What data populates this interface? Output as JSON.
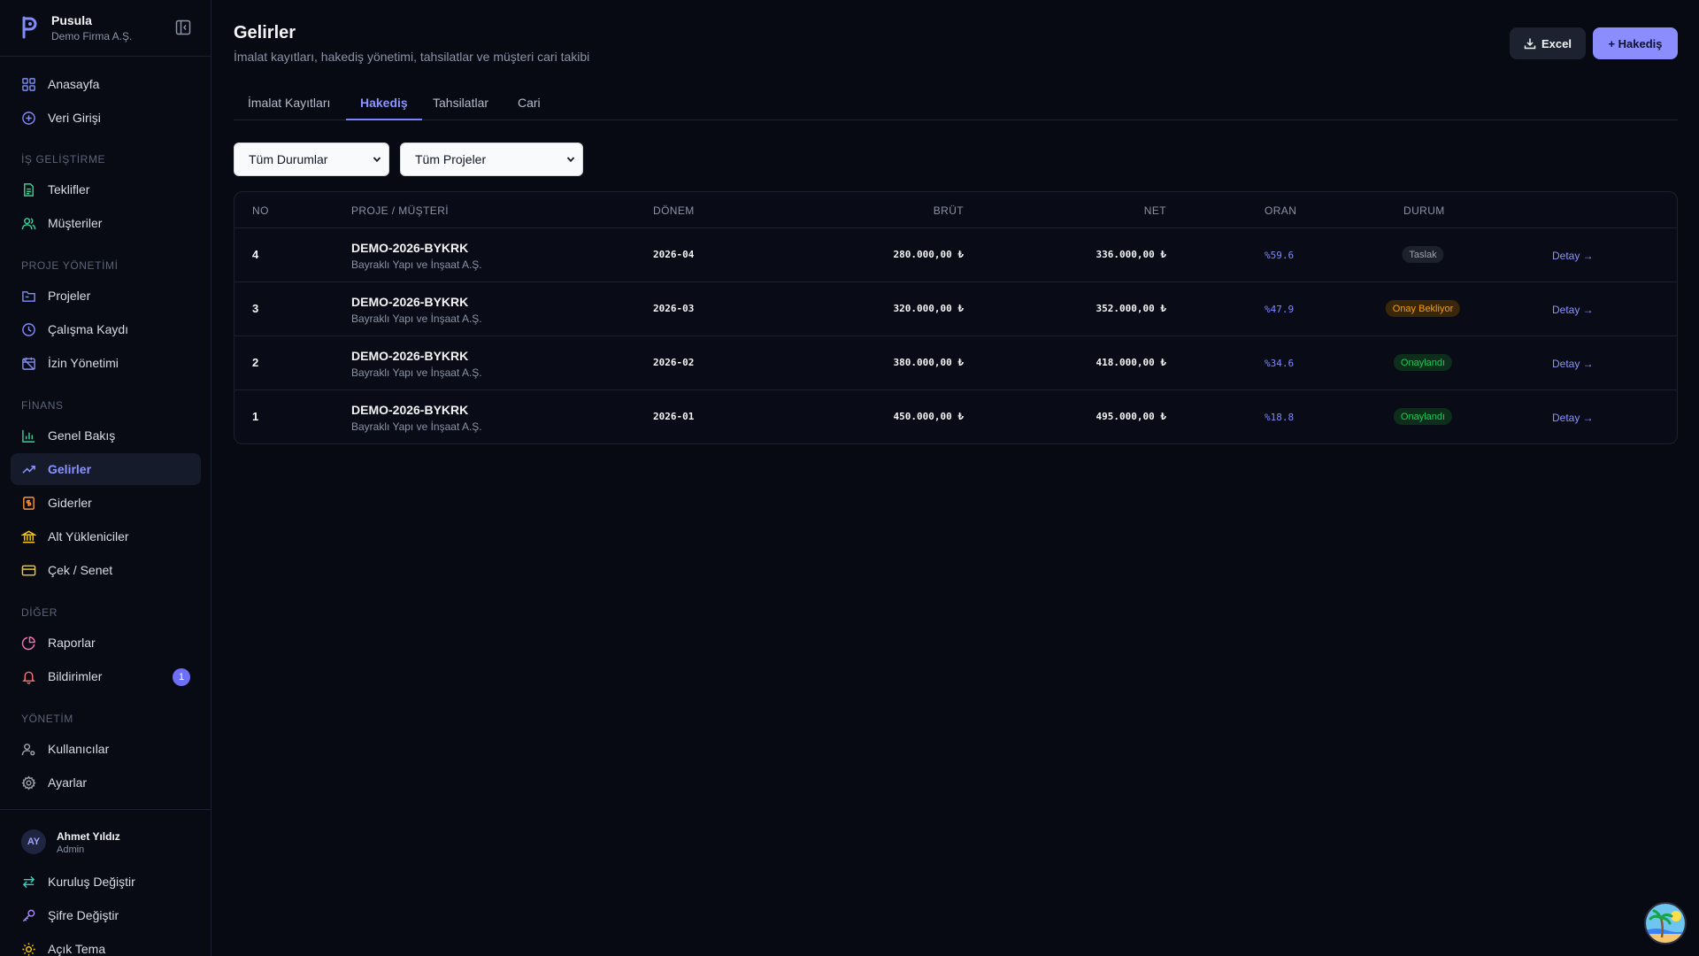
{
  "brand": {
    "name": "Pusula",
    "company": "Demo Firma A.Ş."
  },
  "sidebar": {
    "top_items": [
      {
        "label": "Anasayfa",
        "icon": "dashboard-icon"
      },
      {
        "label": "Veri Girişi",
        "icon": "plus-circle-icon"
      }
    ],
    "sections": [
      {
        "label": "İŞ GELİŞTİRME",
        "items": [
          {
            "label": "Teklifler",
            "icon": "document-icon",
            "color": "#34d399"
          },
          {
            "label": "Müşteriler",
            "icon": "users-icon",
            "color": "#34d399"
          }
        ]
      },
      {
        "label": "PROJE YÖNETİMİ",
        "items": [
          {
            "label": "Projeler",
            "icon": "folder-icon",
            "color": "#818cf8"
          },
          {
            "label": "Çalışma Kaydı",
            "icon": "clock-icon",
            "color": "#818cf8"
          },
          {
            "label": "İzin Yönetimi",
            "icon": "calendar-off-icon",
            "color": "#818cf8"
          }
        ]
      },
      {
        "label": "FİNANS",
        "items": [
          {
            "label": "Genel Bakış",
            "icon": "bar-chart-icon",
            "color": "#34d399"
          },
          {
            "label": "Gelirler",
            "icon": "trending-up-icon",
            "color": "#8b93ff",
            "active": true
          },
          {
            "label": "Giderler",
            "icon": "receipt-icon",
            "color": "#fb923c"
          },
          {
            "label": "Alt Yükleniciler",
            "icon": "bank-icon",
            "color": "#facc15"
          },
          {
            "label": "Çek / Senet",
            "icon": "credit-card-icon",
            "color": "#facc15"
          }
        ]
      },
      {
        "label": "DİĞER",
        "items": [
          {
            "label": "Raporlar",
            "icon": "pie-chart-icon",
            "color": "#f472b6"
          },
          {
            "label": "Bildirimler",
            "icon": "bell-icon",
            "color": "#f87171",
            "badge": "1"
          }
        ]
      },
      {
        "label": "YÖNETİM",
        "items": [
          {
            "label": "Kullanıcılar",
            "icon": "user-cog-icon",
            "color": "#9ca3af"
          },
          {
            "label": "Ayarlar",
            "icon": "gear-icon",
            "color": "#9ca3af"
          }
        ]
      }
    ],
    "user": {
      "initials": "AY",
      "name": "Ahmet Yıldız",
      "role": "Admin"
    },
    "bottom_items": [
      {
        "label": "Kuruluş Değiştir",
        "icon": "swap-icon",
        "color": "#2dd4bf"
      },
      {
        "label": "Şifre Değiştir",
        "icon": "key-icon",
        "color": "#a78bfa"
      },
      {
        "label": "Açık Tema",
        "icon": "sun-icon",
        "color": "#facc15"
      }
    ]
  },
  "header": {
    "title": "Gelirler",
    "subtitle": "İmalat kayıtları, hakediş yönetimi, tahsilatlar ve müşteri cari takibi",
    "excel_label": "Excel",
    "add_label": "+ Hakediş"
  },
  "tabs": [
    {
      "label": "İmalat Kayıtları"
    },
    {
      "label": "Hakediş",
      "active": true
    },
    {
      "label": "Tahsilatlar"
    },
    {
      "label": "Cari"
    }
  ],
  "filters": {
    "status": "Tüm Durumlar",
    "project": "Tüm Projeler"
  },
  "table": {
    "columns": [
      "NO",
      "PROJE / MÜŞTERİ",
      "DÖNEM",
      "BRÜT",
      "NET",
      "ORAN",
      "DURUM"
    ],
    "rows": [
      {
        "no": "4",
        "project": "DEMO-2026-BYKRK",
        "customer": "Bayraklı Yapı ve İnşaat A.Ş.",
        "period": "2026-04",
        "gross": "280.000,00 ₺",
        "net": "336.000,00 ₺",
        "rate": "%59.6",
        "status": "Taslak",
        "status_kind": "draft",
        "action": "Detay →"
      },
      {
        "no": "3",
        "project": "DEMO-2026-BYKRK",
        "customer": "Bayraklı Yapı ve İnşaat A.Ş.",
        "period": "2026-03",
        "gross": "320.000,00 ₺",
        "net": "352.000,00 ₺",
        "rate": "%47.9",
        "status": "Onay Bekliyor",
        "status_kind": "pending",
        "action": "Detay →"
      },
      {
        "no": "2",
        "project": "DEMO-2026-BYKRK",
        "customer": "Bayraklı Yapı ve İnşaat A.Ş.",
        "period": "2026-02",
        "gross": "380.000,00 ₺",
        "net": "418.000,00 ₺",
        "rate": "%34.6",
        "status": "Onaylandı",
        "status_kind": "approved",
        "action": "Detay →"
      },
      {
        "no": "1",
        "project": "DEMO-2026-BYKRK",
        "customer": "Bayraklı Yapı ve İnşaat A.Ş.",
        "period": "2026-01",
        "gross": "450.000,00 ₺",
        "net": "495.000,00 ₺",
        "rate": "%18.8",
        "status": "Onaylandı",
        "status_kind": "approved",
        "action": "Detay →"
      }
    ]
  },
  "colors": {
    "accent": "#8b8dff",
    "draft": "#9ca3af",
    "pending": "#f59e0b",
    "approved": "#22c55e"
  }
}
